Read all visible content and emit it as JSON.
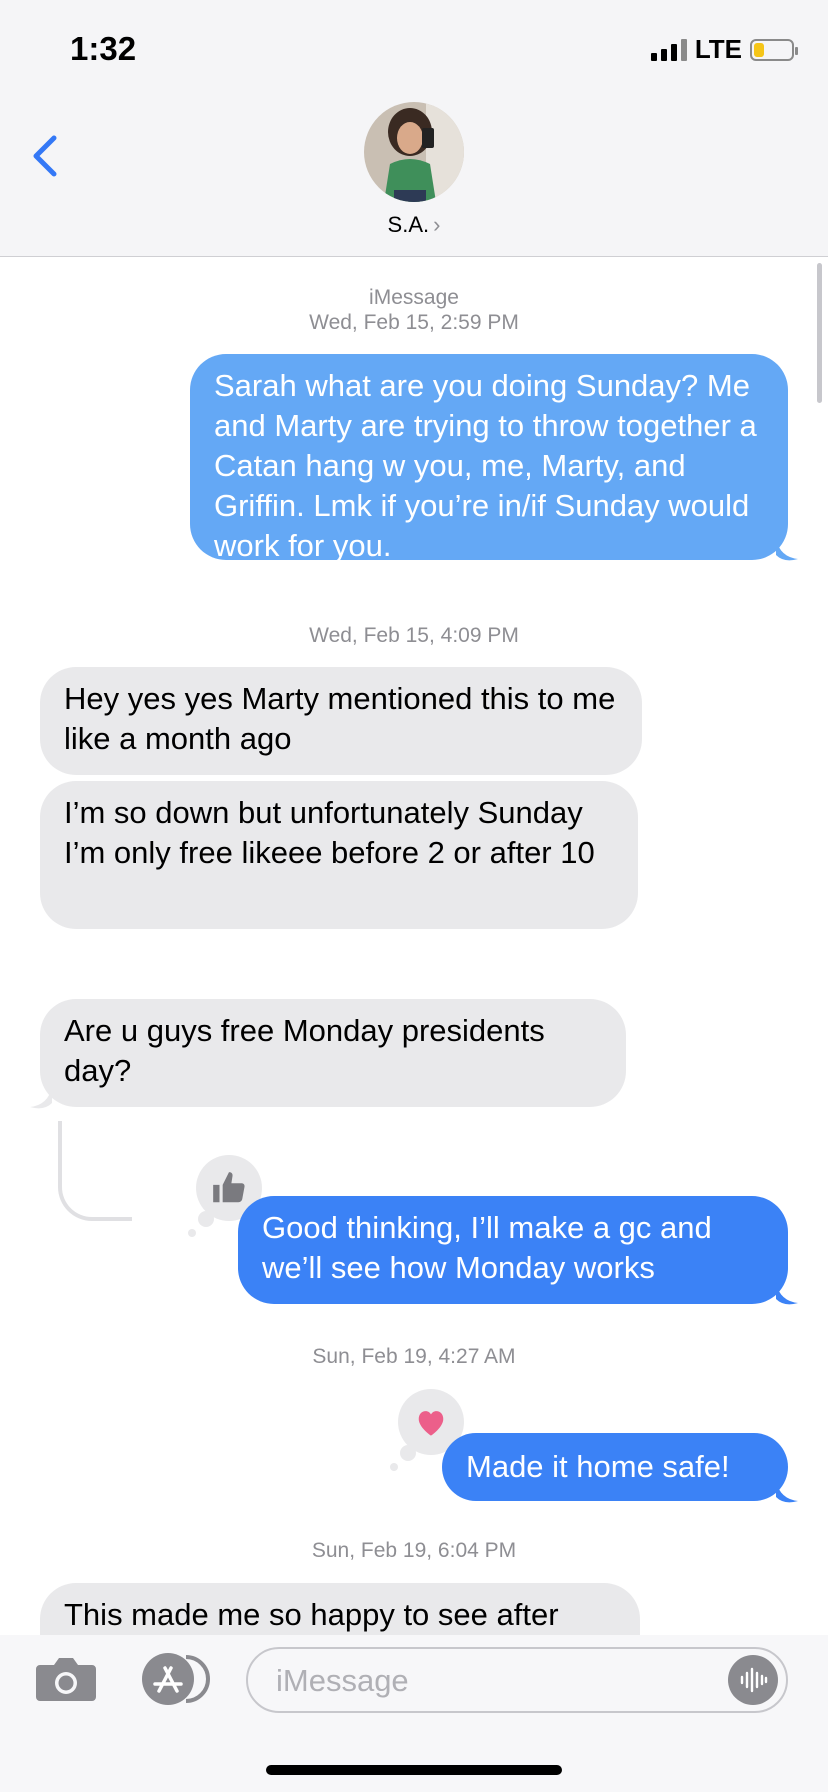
{
  "status_bar": {
    "time": "1:32",
    "network": "LTE",
    "battery_level": 0.28
  },
  "header": {
    "contact_name": "S.A.",
    "chevron": "›",
    "back_icon": "chevron-left-icon"
  },
  "thread": [
    {
      "type": "meta",
      "service": "iMessage",
      "text": "Wed, Feb 15, 2:59 PM"
    },
    {
      "type": "sent",
      "text": "Sarah what are you doing Sunday? Me and Marty are trying to throw together a Catan hang w you, me, Marty, and Griffin. Lmk if you’re in/if Sunday would work for you."
    },
    {
      "type": "meta",
      "text": "Wed, Feb 15, 4:09 PM"
    },
    {
      "type": "received",
      "text": "Hey yes yes Marty mentioned this to me like a month ago"
    },
    {
      "type": "received",
      "text": "I’m so down but unfortunately Sunday I’m only free likeee before 2 or after 10"
    },
    {
      "type": "received",
      "text": "Are u guys free Monday presidents day?"
    },
    {
      "type": "sent",
      "text": "Good thinking, I’ll make a gc and we’ll see how Monday works",
      "tapback": "thumbs-up-icon"
    },
    {
      "type": "meta",
      "text": "Sun, Feb 19, 4:27 AM"
    },
    {
      "type": "sent",
      "text": "Made it home safe!",
      "tapback": "heart-icon"
    },
    {
      "type": "meta",
      "text": "Sun, Feb 19, 6:04 PM"
    },
    {
      "type": "received",
      "text": "This made me so happy to see after"
    }
  ],
  "composer": {
    "placeholder": "iMessage",
    "camera_icon": "camera-icon",
    "apps_icon": "app-store-icon",
    "audio_icon": "audio-waveform-icon"
  },
  "colors": {
    "sent_bubble": "#3b82f6",
    "sent_bubble_light": "#64a8f5",
    "received_bubble": "#e9e9eb",
    "accent": "#3478f6",
    "heart": "#ec5f8a"
  }
}
